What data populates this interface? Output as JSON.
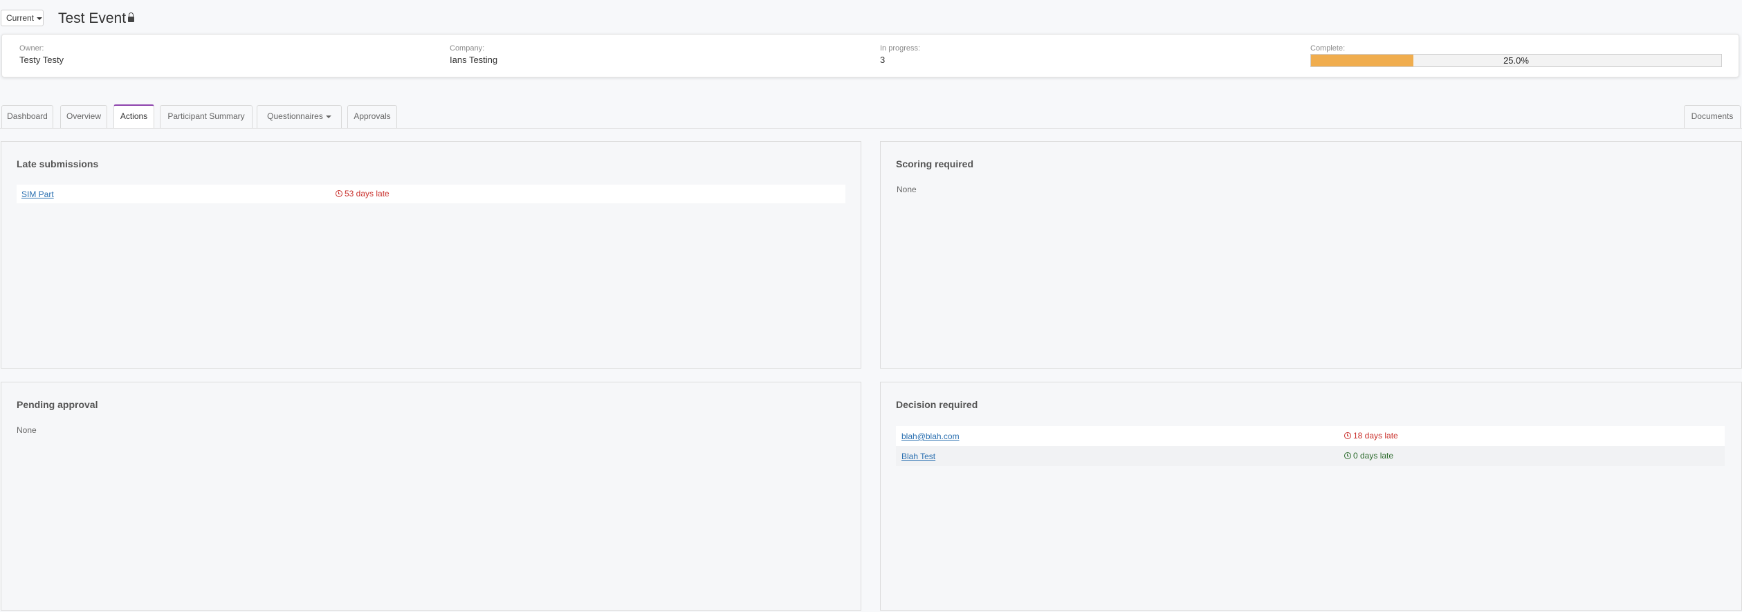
{
  "header": {
    "version_label": "Current",
    "title": "Test Event"
  },
  "info": {
    "owner_label": "Owner:",
    "owner_value": "Testy Testy",
    "company_label": "Company:",
    "company_value": "Ians Testing",
    "in_progress_label": "In progress:",
    "in_progress_value": "3",
    "complete_label": "Complete:",
    "complete_percent": 25.0,
    "complete_text": "25.0%",
    "accent_color": "#f0ad4e"
  },
  "tabs": [
    {
      "label": "Dashboard"
    },
    {
      "label": "Overview"
    },
    {
      "label": "Actions",
      "active": true
    },
    {
      "label": "Participant Summary"
    },
    {
      "label": "Questionnaires"
    },
    {
      "label": "Approvals"
    },
    {
      "label": "Documents"
    }
  ],
  "late_submissions": {
    "title": "Late submissions",
    "rows": [
      {
        "name": "SIM Part",
        "status": "53 days late"
      }
    ]
  },
  "scoring_required": {
    "title": "Scoring required",
    "empty": "None"
  },
  "pending_approval": {
    "title": "Pending approval",
    "empty": "None"
  },
  "decision_required": {
    "title": "Decision required",
    "rows": [
      {
        "name": "blah@blah.com",
        "status": "18 days late"
      },
      {
        "name": "Blah Test",
        "status": "0 days late"
      }
    ]
  },
  "colors": {
    "late_red": "#c9302c",
    "ontime_green": "#2d6b2d",
    "active_tab": "#8e44ad"
  }
}
